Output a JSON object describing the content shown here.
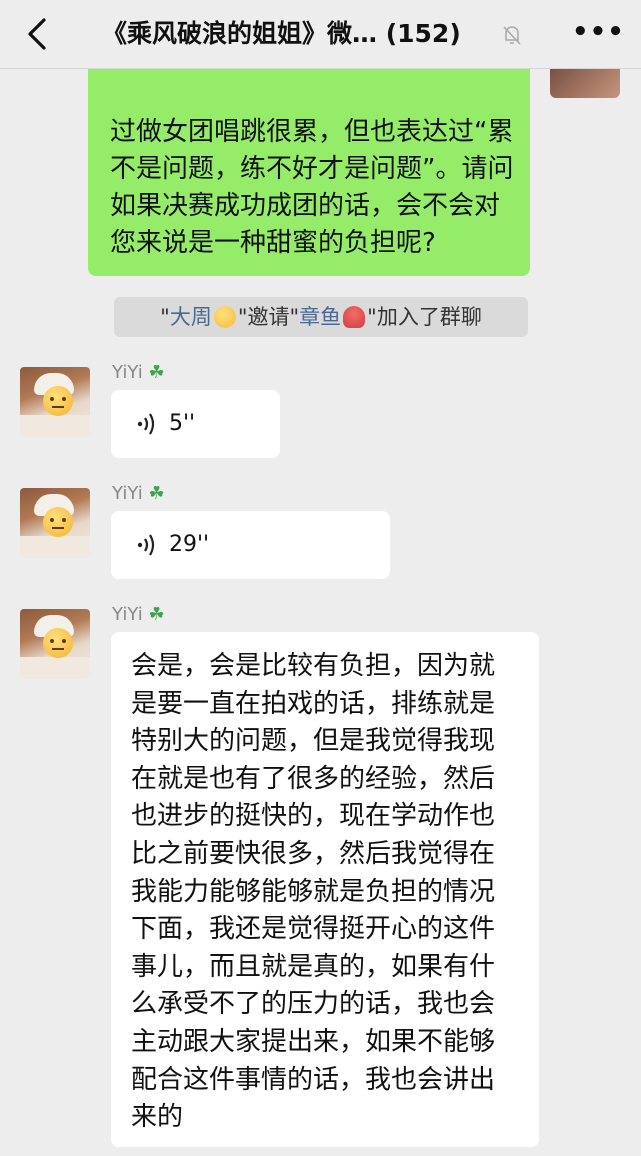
{
  "header": {
    "title": "《乘风破浪的姐姐》微… (152)",
    "more_label": "•••"
  },
  "messages": {
    "outgoing_text": "过做女团唱跳很累，但也表达过“累不是问题，练不好才是问题”。请问如果决赛成功成团的话，会不会对您来说是一种甜蜜的负担呢?",
    "system": {
      "q1": "\"",
      "inviter": "大周",
      "invite": "\"邀请\"",
      "invitee": "章鱼",
      "joined": "\"加入了群聊"
    },
    "voice1": {
      "sender": "YiYi",
      "duration": "5''"
    },
    "voice2": {
      "sender": "YiYi",
      "duration": "29''"
    },
    "text1": {
      "sender": "YiYi",
      "text": "会是，会是比较有负担，因为就是要一直在拍戏的话，排练就是特别大的问题，但是我觉得我现在就是也有了很多的经验，然后也进步的挺快的，现在学动作也比之前要快很多，然后我觉得在我能力能够能够就是负担的情况下面，我还是觉得挺开心的这件事儿，而且就是真的，如果有什么承受不了的压力的话，我也会主动跟大家提出来，如果不能够配合这件事情的话，我也会讲出来的"
    }
  },
  "colors": {
    "outgoing_bubble": "#95ec69",
    "incoming_bubble": "#ffffff",
    "background": "#ededed",
    "link": "#4a6891"
  },
  "icons": [
    "back-arrow-icon",
    "mute-bell-icon",
    "more-icon",
    "voice-wave-icon",
    "clover-icon",
    "wink-emoji-icon",
    "octopus-emoji-icon"
  ]
}
